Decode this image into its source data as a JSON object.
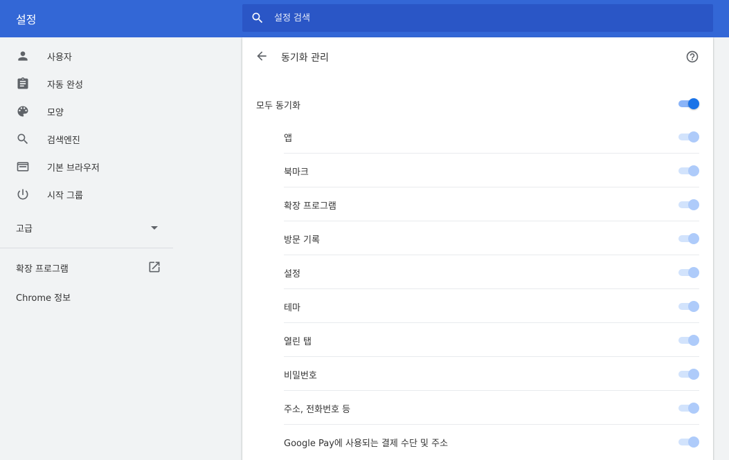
{
  "header": {
    "title": "설정",
    "search_placeholder": "설정 검색"
  },
  "sidebar": {
    "items": [
      {
        "label": "사용자",
        "icon": "person-icon"
      },
      {
        "label": "자동 완성",
        "icon": "clipboard-icon"
      },
      {
        "label": "모양",
        "icon": "palette-icon"
      },
      {
        "label": "검색엔진",
        "icon": "search-icon"
      },
      {
        "label": "기본 브라우저",
        "icon": "browser-window-icon"
      },
      {
        "label": "시작 그룹",
        "icon": "power-icon"
      }
    ],
    "advanced_label": "고급",
    "extensions_label": "확장 프로그램",
    "about_label": "Chrome 정보"
  },
  "main": {
    "title": "동기화 관리",
    "sync_all": {
      "label": "모두 동기화",
      "enabled": true
    },
    "items": [
      {
        "label": "앱",
        "enabled": true
      },
      {
        "label": "북마크",
        "enabled": true
      },
      {
        "label": "확장 프로그램",
        "enabled": true
      },
      {
        "label": "방문 기록",
        "enabled": true
      },
      {
        "label": "설정",
        "enabled": true
      },
      {
        "label": "테마",
        "enabled": true
      },
      {
        "label": "열린 탭",
        "enabled": true
      },
      {
        "label": "비밀번호",
        "enabled": true
      },
      {
        "label": "주소, 전화번호 등",
        "enabled": true
      },
      {
        "label": "Google Pay에 사용되는 결제 수단 및 주소",
        "enabled": true
      }
    ]
  },
  "colors": {
    "header_bg": "#3367d6",
    "search_bg": "#2a56c6",
    "toggle_on": "#1a73e8",
    "toggle_disabled": "#aecbfa"
  }
}
